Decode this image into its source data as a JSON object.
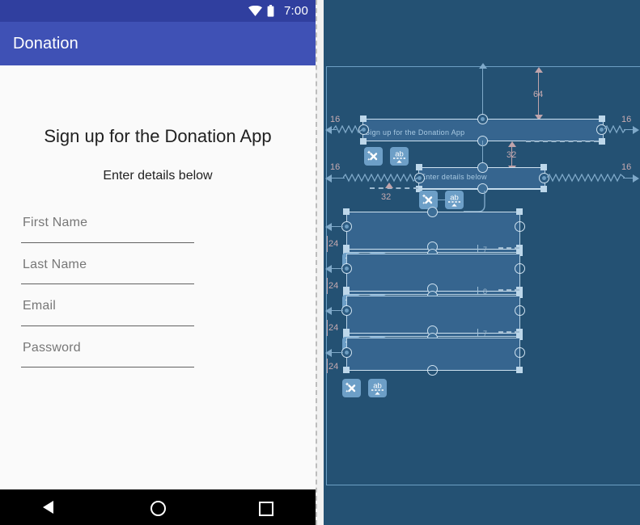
{
  "app": {
    "title": "Donation",
    "statusbar": {
      "time": "7:00",
      "wifi_icon": "wifi-icon",
      "battery_icon": "battery-icon"
    },
    "colors": {
      "statusbar_bg": "#303f9f",
      "appbar_bg": "#3f51b5",
      "screen_bg": "#fafafa",
      "blueprint_bg": "#245173",
      "blueprint_widget": "#36658f",
      "blueprint_stroke": "#cfe2f0",
      "margin_label": "#c6aab0",
      "navbar_bg": "#000000"
    },
    "content": {
      "headline": "Sign up for the Donation App",
      "subhead": "Enter details below",
      "fields": [
        {
          "label": "First Name",
          "value": "",
          "placeholder": "First Name"
        },
        {
          "label": "Last Name",
          "value": "",
          "placeholder": "Last Name"
        },
        {
          "label": "Email",
          "value": "",
          "placeholder": "Email"
        },
        {
          "label": "Password",
          "value": "",
          "placeholder": "Password"
        }
      ]
    },
    "navbar": {
      "back": "back-icon",
      "home": "home-icon",
      "recents": "recents-icon"
    }
  },
  "blueprint": {
    "texts": {
      "headline": "Sign up for the Donation App",
      "subhead": "Enter details below"
    },
    "margins": {
      "headline_top": "64",
      "headline_left": "16",
      "headline_right": "16",
      "subhead_top": "32",
      "subhead_left": "16",
      "subhead_right": "16",
      "subhead_bottom": "32",
      "field1_top": "24",
      "field2_top": "24",
      "field3_top": "24",
      "field4_top": "24"
    },
    "baselines": [
      {
        "row": "last-name",
        "value": "7"
      },
      {
        "row": "email",
        "value": "8"
      },
      {
        "row": "password",
        "value": "7"
      }
    ],
    "badges": {
      "clear_constraints": "clear-constraints-icon",
      "baseline": "baseline-ab-icon"
    }
  }
}
